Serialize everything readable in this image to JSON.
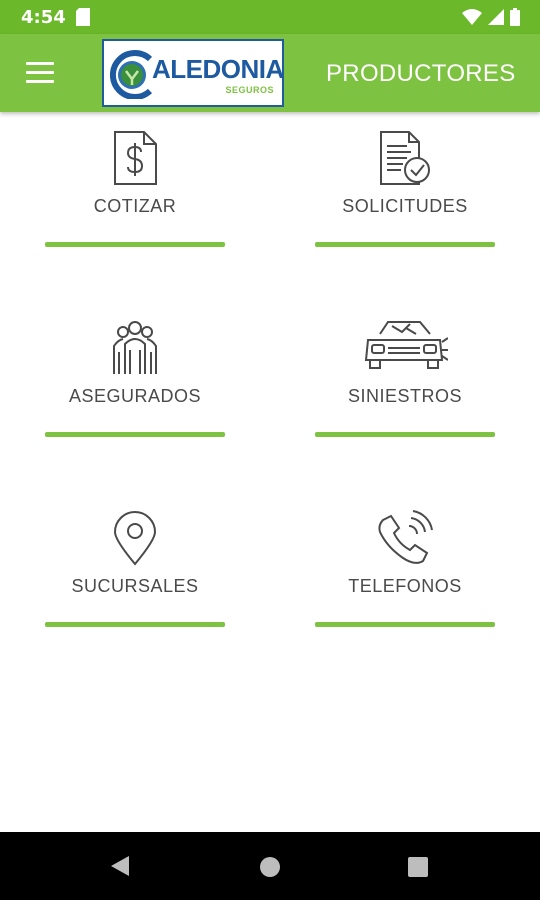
{
  "status_bar": {
    "time": "4:54"
  },
  "app_bar": {
    "logo_text": "ALEDONIA",
    "logo_sub": "SEGUROS",
    "title": "PRODUCTORES"
  },
  "tiles": [
    {
      "label": "COTIZAR",
      "icon": "dollar-document-icon"
    },
    {
      "label": "SOLICITUDES",
      "icon": "approved-document-icon"
    },
    {
      "label": "ASEGURADOS",
      "icon": "people-group-icon"
    },
    {
      "label": "SINIESTROS",
      "icon": "crashed-car-icon"
    },
    {
      "label": "SUCURSALES",
      "icon": "location-pin-icon"
    },
    {
      "label": "TELEFONOS",
      "icon": "phone-ringing-icon"
    }
  ],
  "colors": {
    "status_bar": "#6bb82a",
    "app_bar": "#7ec242",
    "accent": "#7ec242",
    "logo_blue": "#1e5aa0"
  }
}
